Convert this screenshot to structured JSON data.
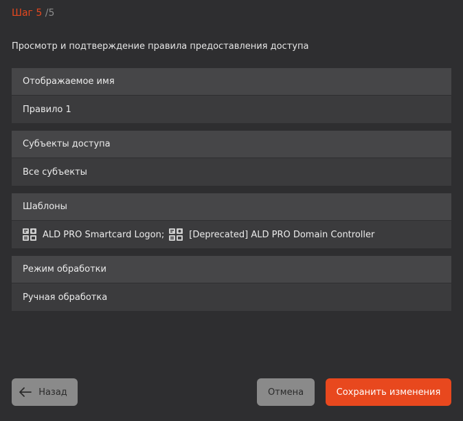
{
  "wizard": {
    "step_current": "Шаг 5",
    "step_separator": "/",
    "step_total": "5",
    "subtitle": "Просмотр и подтверждение правила предоставления доступа"
  },
  "sections": {
    "display_name": {
      "label": "Отображаемое имя",
      "value": "Правило 1"
    },
    "subjects": {
      "label": "Субъекты доступа",
      "value": "Все субъекты"
    },
    "templates": {
      "label": "Шаблоны",
      "items": [
        "ALD PRO Smartcard Logon",
        "[Deprecated] ALD PRO Domain Controller"
      ],
      "separator": ";",
      "icon": "certificate-template-icon"
    },
    "processing_mode": {
      "label": "Режим обработки",
      "value": "Ручная обработка"
    }
  },
  "footer": {
    "back_label": "Назад",
    "cancel_label": "Отмена",
    "save_label": "Сохранить изменения"
  },
  "colors": {
    "accent": "#e8481e",
    "background": "#2e2e30",
    "card_header": "#464648",
    "card_body": "#3b3b3d",
    "secondary_button": "#8a8a8a"
  }
}
